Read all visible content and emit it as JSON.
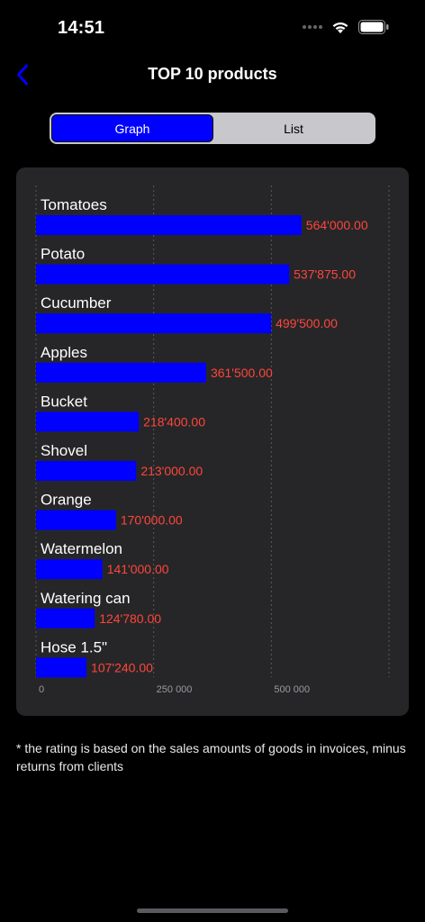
{
  "status_bar": {
    "time": "14:51"
  },
  "nav": {
    "title": "TOP 10 products",
    "back_icon": "chevron-left-icon"
  },
  "segments": {
    "graph": "Graph",
    "list": "List",
    "selected": "Graph"
  },
  "colors": {
    "bar": "#0000ff",
    "value_label": "#ff453a",
    "accent": "#0000ff"
  },
  "chart_data": {
    "type": "bar",
    "orientation": "horizontal",
    "categories": [
      "Tomatoes",
      "Potato",
      "Cucumber",
      "Apples",
      "Bucket",
      "Shovel",
      "Orange",
      "Watermelon",
      "Watering can",
      "Hose 1.5\""
    ],
    "values": [
      564000,
      537875,
      499500,
      361500,
      218400,
      213000,
      170000,
      141000,
      124780,
      107240
    ],
    "value_labels": [
      "564'000.00",
      "537'875.00",
      "499'500.00",
      "361'500.00",
      "218'400.00",
      "213'000.00",
      "170'000.00",
      "141'000.00",
      "124'780.00",
      "107'240.00"
    ],
    "x_ticks": [
      0,
      250000,
      500000,
      750000
    ],
    "x_tick_labels": [
      "0",
      "250 000",
      "500 000",
      ""
    ],
    "xlim": [
      0,
      750000
    ],
    "grid": true
  },
  "footnote": "* the rating is based on the sales amounts of goods in invoices, minus returns from clients"
}
